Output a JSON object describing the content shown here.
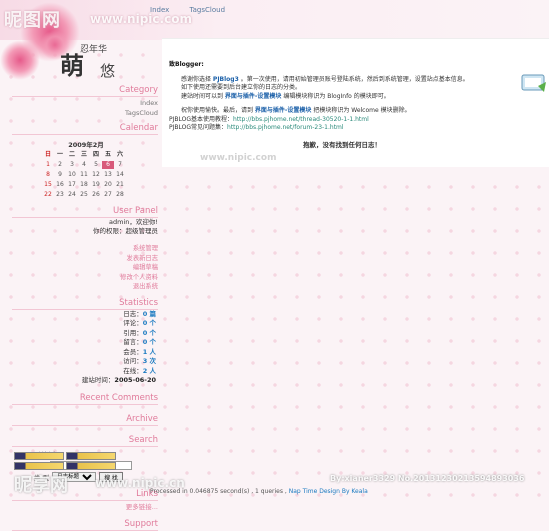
{
  "watermark": {
    "top_brand": "昵图网",
    "top_url": "www.nipic.com",
    "bottom_brand": "昵享网",
    "bottom_url": "www.nipic.cn",
    "user_id": "By:xianer3329 No.20131230213594893036"
  },
  "topnav": [
    "Index",
    "TagsCloud"
  ],
  "logo": {
    "big": "萌",
    "small_top": "忍年华",
    "small_bottom": "悠"
  },
  "sidebar": {
    "category": {
      "title": "Category",
      "links": [
        "Index",
        "TagsCloud"
      ]
    },
    "calendar": {
      "title": "Calendar",
      "month": "2009年2月",
      "weekdays": [
        "日",
        "一",
        "二",
        "三",
        "四",
        "五",
        "六"
      ],
      "days": [
        "1",
        "2",
        "3",
        "4",
        "5",
        "6",
        "7",
        "8",
        "9",
        "10",
        "11",
        "12",
        "13",
        "14",
        "15",
        "16",
        "17",
        "18",
        "19",
        "20",
        "21",
        "22",
        "23",
        "24",
        "25",
        "26",
        "27",
        "28"
      ],
      "today": "6"
    },
    "user_panel": {
      "title": "User Panel",
      "welcome": "admin，欢迎你!",
      "role": "你的权限：超级管理员",
      "links": [
        "系统管理",
        "发表新日志",
        "编辑草稿",
        "修改个人资料",
        "退出系统"
      ]
    },
    "statistics": {
      "title": "Statistics",
      "rows": [
        {
          "label": "日志",
          "value": "0",
          "unit": "篇"
        },
        {
          "label": "评论",
          "value": "0",
          "unit": "个"
        },
        {
          "label": "引用",
          "value": "0",
          "unit": "个"
        },
        {
          "label": "留言",
          "value": "0",
          "unit": "个"
        },
        {
          "label": "会员",
          "value": "1",
          "unit": "人"
        },
        {
          "label": "访问",
          "value": "3",
          "unit": "次"
        },
        {
          "label": "在线",
          "value": "2",
          "unit": "人"
        }
      ],
      "built_label": "建站时间",
      "built_value": "2005-06-20"
    },
    "recent_comments": {
      "title": "Recent Comments"
    },
    "archive": {
      "title": "Archive"
    },
    "search": {
      "title": "Search",
      "keyword_label": "关键字",
      "type_label": "类 型",
      "type_value": "日志标题",
      "button": "搜 找"
    },
    "links": {
      "title": "Links",
      "more": "更多链接..."
    },
    "support": {
      "title": "Support"
    }
  },
  "main": {
    "greeting": "致Blogger:",
    "paragraphs": [
      {
        "prefix": "感谢你选择 ",
        "bold": "PJBlog3",
        "suffix": " 。第一次使用，请用初始管理员账号登陆系统，然后到系统管理，设置站点基本信息。"
      },
      {
        "text": "如下使用还需要到后台建立你的日志的分类。"
      },
      {
        "prefix": "建站时间可以到 ",
        "bold": "界面与插件-设置模块",
        "suffix": " 编辑模块称识为 BlogInfo 的模块即可。"
      },
      {
        "prefix": "祝你使用愉快。最后，请到 ",
        "bold": "界面与插件-设置模块",
        "suffix": " 把模块称识为 Welcome 模块删除。"
      }
    ],
    "help_lines": [
      {
        "label": "PJBLOG基本使用教程：",
        "url": "http://bbs.pjhome.net/thread-30520-1-1.html"
      },
      {
        "label": "PJBLOG常见问题集：",
        "url": "http://bbs.pjhome.net/forum-23-1.html"
      }
    ],
    "not_found": "抱歉，没有找到任何日志！"
  },
  "footer": {
    "processed": "Processed in 0.046875 second(s) , 1 queries",
    "theme": "Nap Time Design By Keala"
  }
}
